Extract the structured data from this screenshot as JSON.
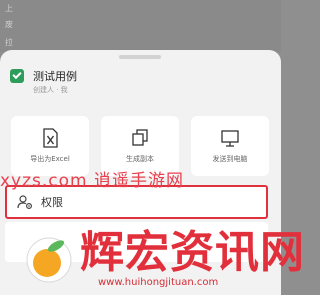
{
  "background": {
    "letters": [
      "上",
      "废",
      "拉"
    ]
  },
  "file": {
    "title": "测试用例",
    "subtitle": "创建人 · 我"
  },
  "actions": [
    {
      "label": "导出为Excel",
      "icon": "excel-export-icon"
    },
    {
      "label": "生成副本",
      "icon": "copy-icon"
    },
    {
      "label": "发送到电脑",
      "icon": "monitor-icon"
    }
  ],
  "permission": {
    "label": "权限",
    "icon": "user-settings-icon"
  },
  "watermark": {
    "text": "xyzs.com 逍遥手游网",
    "brand": "辉宏资讯网",
    "url": "www.huihongjituan.com"
  },
  "colors": {
    "accent_red": "#e0313f",
    "file_green": "#2e9d5b"
  }
}
